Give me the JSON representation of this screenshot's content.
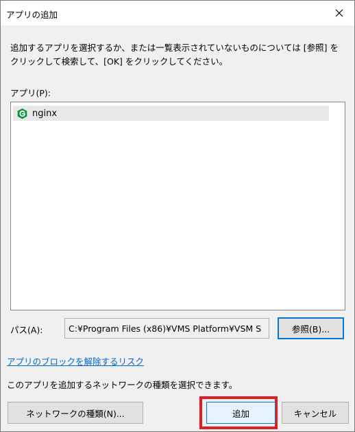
{
  "dialog": {
    "title": "アプリの追加",
    "description": "追加するアプリを選択するか、または一覧表示されていないものについては [参照] を\nクリックして検索して、[OK] をクリックしてください。",
    "apps_label": "アプリ(P):",
    "apps": [
      {
        "name": "nginx",
        "icon": "nginx-icon",
        "selected": true
      }
    ],
    "path_label": "パス(A):",
    "path_value": "C:¥Program Files (x86)¥VMS Platform¥VSM S",
    "browse_label": "参照(B)...",
    "block_risk_link": "アプリのブロックを解除するリスク",
    "network_desc": "このアプリを追加するネットワークの種類を選択できます。",
    "network_button": "ネットワークの種類(N)...",
    "add_button": "追加",
    "cancel_button": "キャンセル"
  },
  "colors": {
    "accent": "#0078d7",
    "highlight": "#e31b23",
    "nginx": "#009639",
    "link": "#0066cc"
  }
}
